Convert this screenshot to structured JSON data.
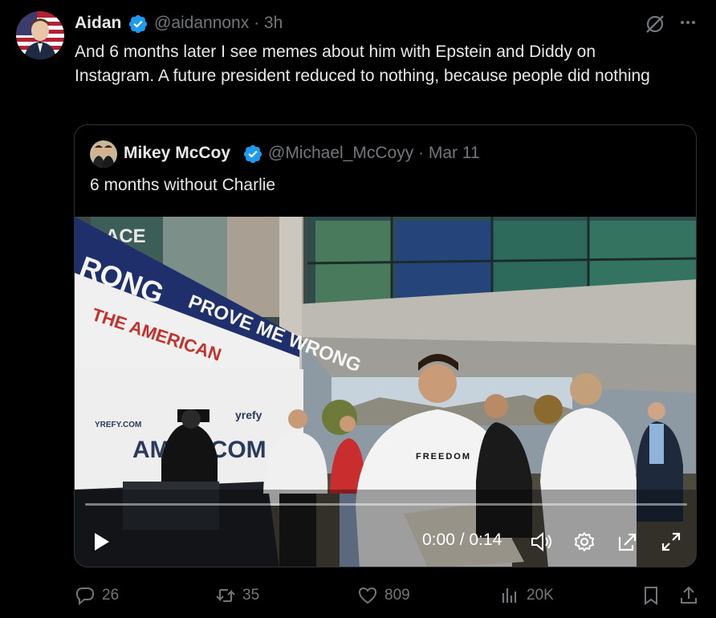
{
  "tweet": {
    "author_name": "Aidan",
    "handle_time": "@aidannonx · 3h",
    "text": "And 6 months later I see memes about him with Epstein and Diddy on Instagram. A future president reduced to nothing, because people did nothing"
  },
  "quoted": {
    "author_name": "Mikey McCoy",
    "handle_time": "@Michael_McCoyy · Mar 11",
    "text": "6 months without Charlie",
    "video": {
      "time_display": "0:00 / 0:14",
      "progress": 0,
      "scene_text": {
        "banner_left": "RONG",
        "banner_main": "PROVE ME WRONG",
        "sign_ace": "ACE",
        "shirt": "FREEDOM",
        "booth_brand": "yrefy",
        "booth_site": "YREFY.COM",
        "booth_big": "AMER COM",
        "tent_red": "THE AMERICAN"
      }
    }
  },
  "actions": {
    "replies": "26",
    "reposts": "35",
    "likes": "809",
    "views": "20K"
  },
  "colors": {
    "background": "#000000",
    "text": "#e7e9ea",
    "muted": "#71767b",
    "verified": "#1d9bf0",
    "border": "#2f3336"
  }
}
